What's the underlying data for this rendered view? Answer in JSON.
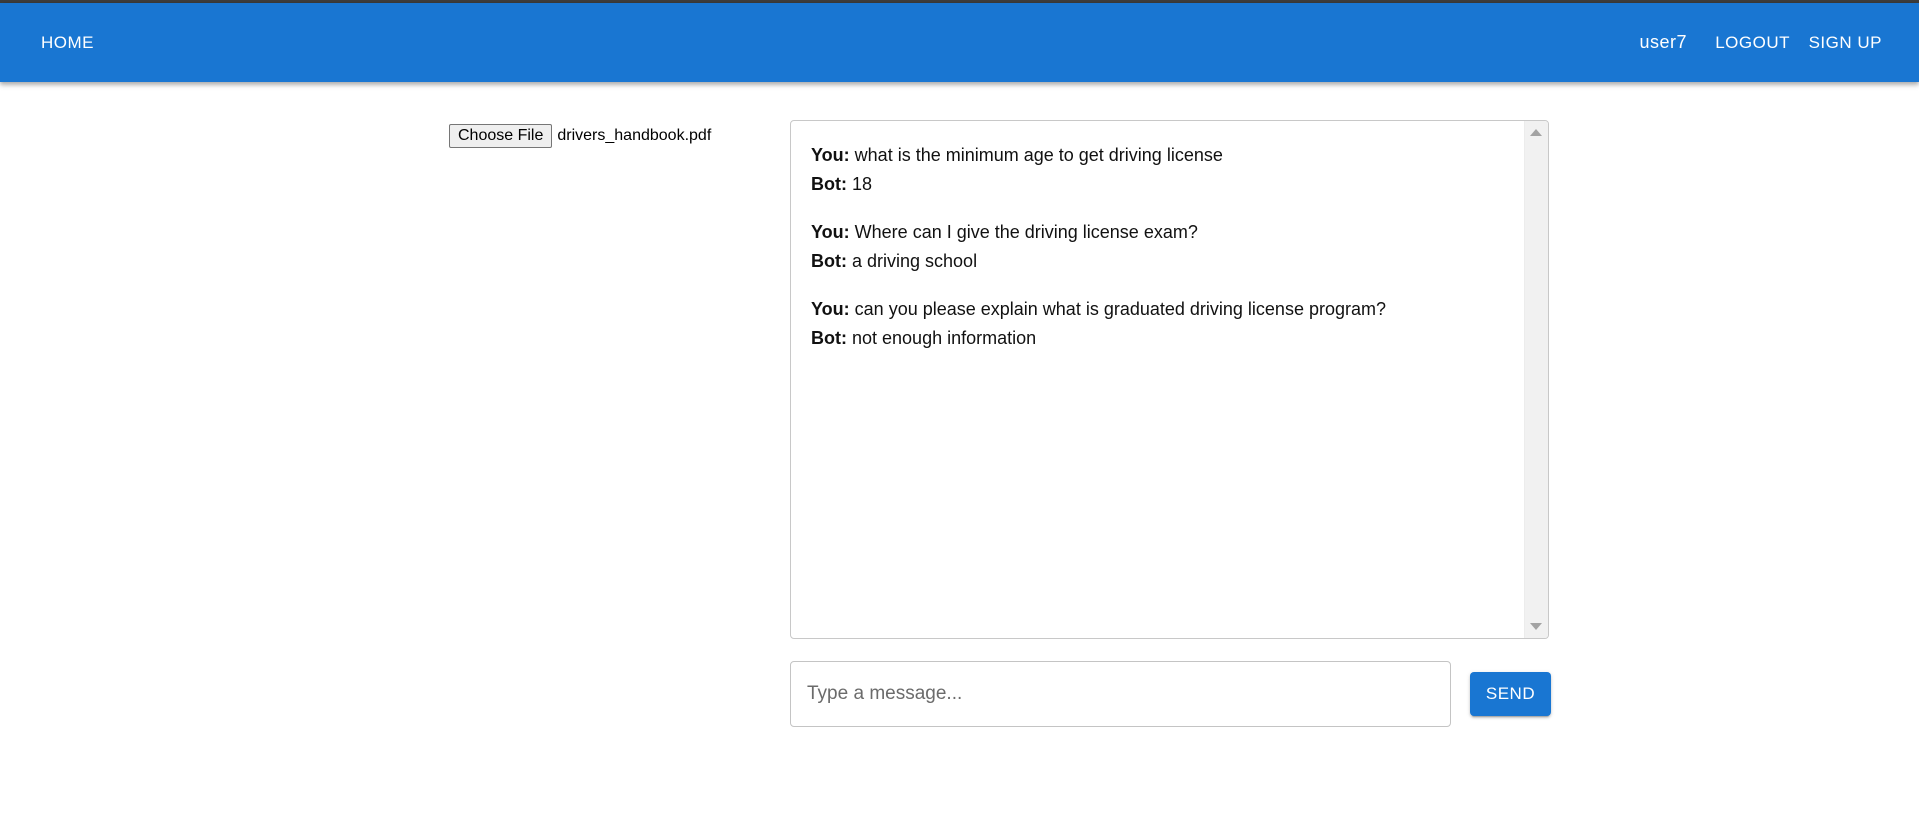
{
  "appbar": {
    "home_label": "HOME",
    "username": "user7",
    "logout_label": "LOGOUT",
    "signup_label": "SIGN UP",
    "color": "#1976d2"
  },
  "upload": {
    "button_label": "Choose File",
    "file_name": "drivers_handbook.pdf"
  },
  "chat": {
    "messages": [
      {
        "you_label": "You:",
        "question": "what is the minimum age to get driving license",
        "bot_label": "Bot:",
        "answer": "18"
      },
      {
        "you_label": "You:",
        "question": "Where can I give the driving license exam?",
        "bot_label": "Bot:",
        "answer": "a driving school"
      },
      {
        "you_label": "You:",
        "question": "can you please explain what is graduated driving license program?",
        "bot_label": "Bot:",
        "answer": "not enough information"
      }
    ]
  },
  "composer": {
    "placeholder": "Type a message...",
    "value": "",
    "send_label": "SEND"
  }
}
